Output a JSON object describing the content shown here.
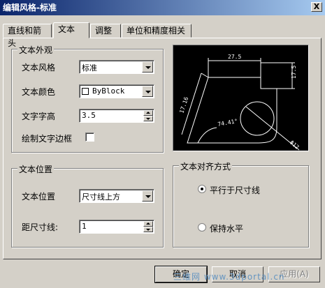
{
  "window": {
    "title": "编辑风格-标准",
    "close_label": "X"
  },
  "tabs": [
    {
      "label": "直线和箭头"
    },
    {
      "label": "文本",
      "active": true
    },
    {
      "label": "调整"
    },
    {
      "label": "单位和精度相关"
    }
  ],
  "text_appearance": {
    "title": "文本外观",
    "style_label": "文本风格",
    "style_value": "标准",
    "color_label": "文本颜色",
    "color_value": "ByBlock",
    "height_label": "文字字高",
    "height_value": "3.5",
    "frame_label": "绘制文字边框",
    "frame_checked": false
  },
  "text_position": {
    "title": "文本位置",
    "position_label": "文本位置",
    "position_value": "尺寸线上方",
    "offset_label": "距尺寸线:",
    "offset_value": "1"
  },
  "alignment": {
    "title": "文本对齐方式",
    "options": [
      {
        "label": "平行于尺寸线",
        "checked": true
      },
      {
        "label": "保持水平",
        "checked": false
      }
    ]
  },
  "preview": {
    "dim_top": "27.5",
    "dim_right": "17.5",
    "dim_left": "17.16",
    "angle": "74.41°",
    "dia": "Φ12"
  },
  "buttons": {
    "ok": "确定",
    "cancel": "取消",
    "apply": "应用(A)"
  },
  "watermark": "三维网 www.3dportal.cn",
  "colors": {
    "title_bar": "#0a246a",
    "dialog_bg": "#d4d0c8",
    "preview_bg": "#000000",
    "preview_lines": "#ffffff"
  }
}
